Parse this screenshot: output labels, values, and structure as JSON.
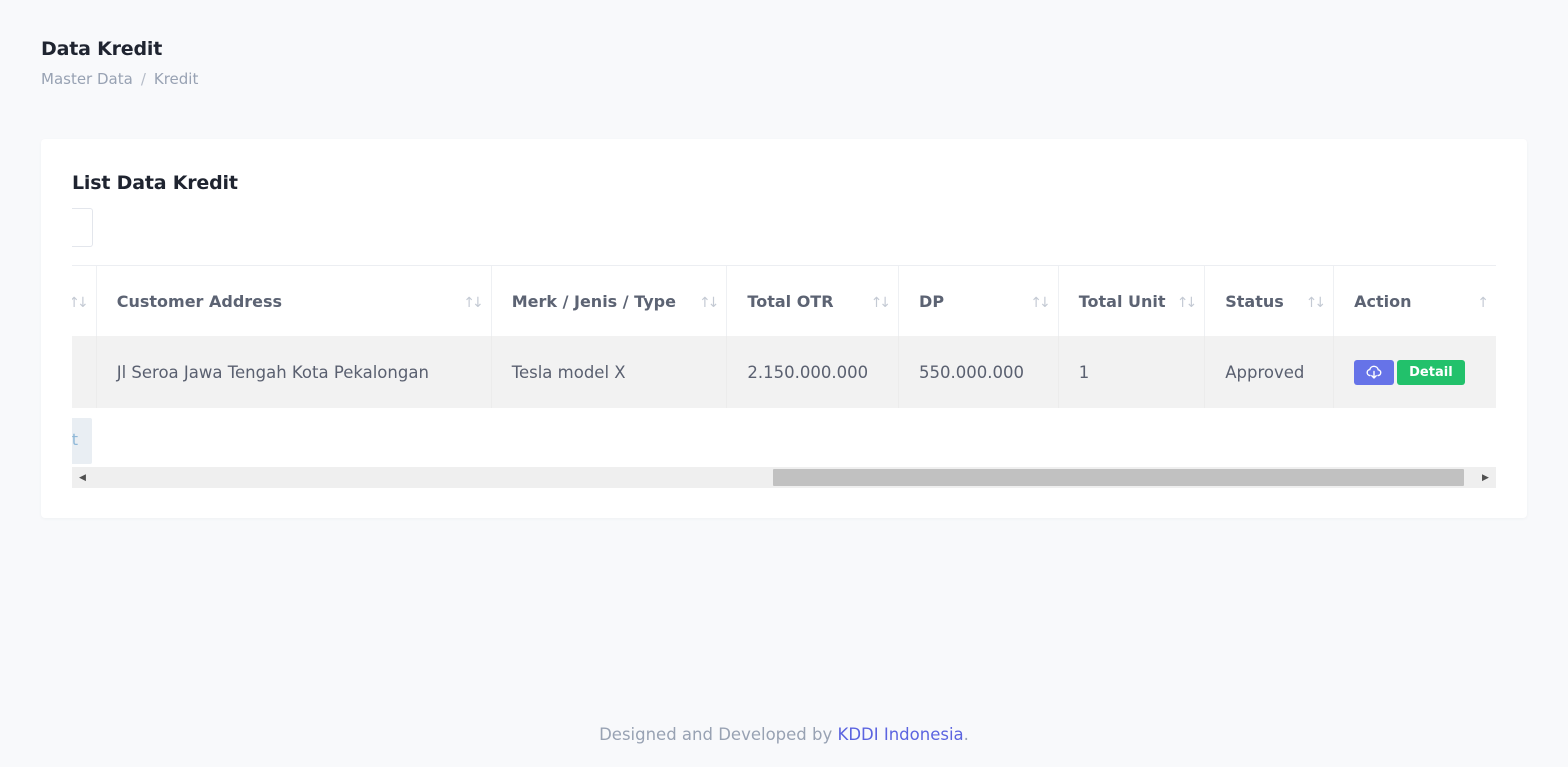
{
  "page": {
    "title": "Data Kredit",
    "breadcrumb": [
      "Master Data",
      "Kredit"
    ]
  },
  "card": {
    "title": "List Data Kredit"
  },
  "table": {
    "columns": [
      {
        "label": "",
        "sort_icon": "↑↓"
      },
      {
        "label": "Customer Address",
        "sort_icon": "↑↓"
      },
      {
        "label": "Merk / Jenis / Type",
        "sort_icon": "↑↓"
      },
      {
        "label": "Total OTR",
        "sort_icon": "↑↓"
      },
      {
        "label": "DP",
        "sort_icon": "↑↓"
      },
      {
        "label": "Total Unit",
        "sort_icon": "↑↓"
      },
      {
        "label": "Status",
        "sort_icon": "↑↓"
      },
      {
        "label": "Action",
        "sort_icon": "↑"
      }
    ],
    "rows": [
      {
        "customer_address": "Jl Seroa Jawa Tengah Kota Pekalongan",
        "merk": "Tesla model X",
        "total_otr": "2.150.000.000",
        "dp": "550.000.000",
        "total_unit": "1",
        "status": "Approved",
        "detail_label": "Detail"
      }
    ]
  },
  "pagination": {
    "clipped_text": "t"
  },
  "scrollbar": {
    "left_arrow": "◀",
    "right_arrow": "▶"
  },
  "footer": {
    "text": "Designed and Developed by ",
    "link": "KDDI Indonesia",
    "suffix": "."
  },
  "colors": {
    "background": "#f8f9fb",
    "download_button": "#6673e8",
    "detail_button": "#22c16b",
    "link": "#5b64e0"
  }
}
